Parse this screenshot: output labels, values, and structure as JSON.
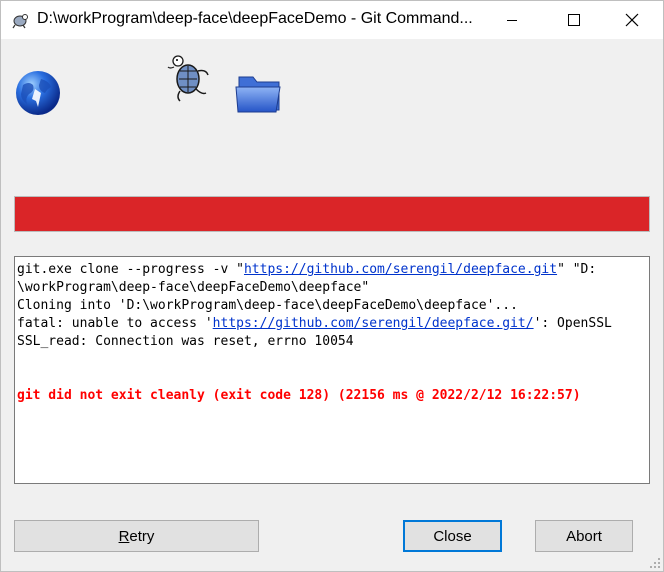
{
  "window": {
    "title": "D:\\workProgram\\deep-face\\deepFaceDemo - Git Command...",
    "controls": {
      "minimize_icon": "minimize-icon",
      "maximize_icon": "maximize-icon",
      "close_icon": "close-icon"
    }
  },
  "toolbar": {
    "icons": [
      "globe-icon",
      "tortoise-icon",
      "folder-icon"
    ]
  },
  "progress": {
    "fraction": 1.0,
    "color": "#da2528"
  },
  "log": {
    "line1_prefix": "git.exe clone --progress -v \"",
    "line1_link": "https://github.com/serengil/deepface.git",
    "line1_suffix": "\" \"D:",
    "line2": "\\workProgram\\deep-face\\deepFaceDemo\\deepface\"",
    "line3": "Cloning into 'D:\\workProgram\\deep-face\\deepFaceDemo\\deepface'...",
    "line4_prefix": "fatal: unable to access '",
    "line4_link": "https://github.com/serengil/deepface.git/",
    "line4_suffix": "': OpenSSL",
    "line5": "SSL_read: Connection was reset, errno 10054",
    "error": "git did not exit cleanly (exit code 128) (22156 ms @ 2022/2/12 16:22:57)",
    "error_color": "#ff0000"
  },
  "buttons": {
    "retry_accel": "R",
    "retry_rest": "etry",
    "close": "Close",
    "abort": "Abort"
  }
}
